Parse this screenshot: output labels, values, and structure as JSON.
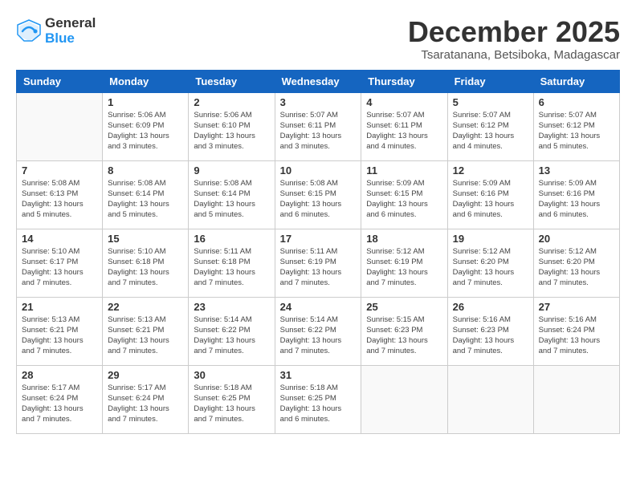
{
  "header": {
    "logo_general": "General",
    "logo_blue": "Blue",
    "month_title": "December 2025",
    "location": "Tsaratanana, Betsiboka, Madagascar"
  },
  "calendar": {
    "days_of_week": [
      "Sunday",
      "Monday",
      "Tuesday",
      "Wednesday",
      "Thursday",
      "Friday",
      "Saturday"
    ],
    "weeks": [
      [
        {
          "day": "",
          "info": ""
        },
        {
          "day": "1",
          "info": "Sunrise: 5:06 AM\nSunset: 6:09 PM\nDaylight: 13 hours\nand 3 minutes."
        },
        {
          "day": "2",
          "info": "Sunrise: 5:06 AM\nSunset: 6:10 PM\nDaylight: 13 hours\nand 3 minutes."
        },
        {
          "day": "3",
          "info": "Sunrise: 5:07 AM\nSunset: 6:11 PM\nDaylight: 13 hours\nand 3 minutes."
        },
        {
          "day": "4",
          "info": "Sunrise: 5:07 AM\nSunset: 6:11 PM\nDaylight: 13 hours\nand 4 minutes."
        },
        {
          "day": "5",
          "info": "Sunrise: 5:07 AM\nSunset: 6:12 PM\nDaylight: 13 hours\nand 4 minutes."
        },
        {
          "day": "6",
          "info": "Sunrise: 5:07 AM\nSunset: 6:12 PM\nDaylight: 13 hours\nand 5 minutes."
        }
      ],
      [
        {
          "day": "7",
          "info": "Sunrise: 5:08 AM\nSunset: 6:13 PM\nDaylight: 13 hours\nand 5 minutes."
        },
        {
          "day": "8",
          "info": "Sunrise: 5:08 AM\nSunset: 6:14 PM\nDaylight: 13 hours\nand 5 minutes."
        },
        {
          "day": "9",
          "info": "Sunrise: 5:08 AM\nSunset: 6:14 PM\nDaylight: 13 hours\nand 5 minutes."
        },
        {
          "day": "10",
          "info": "Sunrise: 5:08 AM\nSunset: 6:15 PM\nDaylight: 13 hours\nand 6 minutes."
        },
        {
          "day": "11",
          "info": "Sunrise: 5:09 AM\nSunset: 6:15 PM\nDaylight: 13 hours\nand 6 minutes."
        },
        {
          "day": "12",
          "info": "Sunrise: 5:09 AM\nSunset: 6:16 PM\nDaylight: 13 hours\nand 6 minutes."
        },
        {
          "day": "13",
          "info": "Sunrise: 5:09 AM\nSunset: 6:16 PM\nDaylight: 13 hours\nand 6 minutes."
        }
      ],
      [
        {
          "day": "14",
          "info": "Sunrise: 5:10 AM\nSunset: 6:17 PM\nDaylight: 13 hours\nand 7 minutes."
        },
        {
          "day": "15",
          "info": "Sunrise: 5:10 AM\nSunset: 6:18 PM\nDaylight: 13 hours\nand 7 minutes."
        },
        {
          "day": "16",
          "info": "Sunrise: 5:11 AM\nSunset: 6:18 PM\nDaylight: 13 hours\nand 7 minutes."
        },
        {
          "day": "17",
          "info": "Sunrise: 5:11 AM\nSunset: 6:19 PM\nDaylight: 13 hours\nand 7 minutes."
        },
        {
          "day": "18",
          "info": "Sunrise: 5:12 AM\nSunset: 6:19 PM\nDaylight: 13 hours\nand 7 minutes."
        },
        {
          "day": "19",
          "info": "Sunrise: 5:12 AM\nSunset: 6:20 PM\nDaylight: 13 hours\nand 7 minutes."
        },
        {
          "day": "20",
          "info": "Sunrise: 5:12 AM\nSunset: 6:20 PM\nDaylight: 13 hours\nand 7 minutes."
        }
      ],
      [
        {
          "day": "21",
          "info": "Sunrise: 5:13 AM\nSunset: 6:21 PM\nDaylight: 13 hours\nand 7 minutes."
        },
        {
          "day": "22",
          "info": "Sunrise: 5:13 AM\nSunset: 6:21 PM\nDaylight: 13 hours\nand 7 minutes."
        },
        {
          "day": "23",
          "info": "Sunrise: 5:14 AM\nSunset: 6:22 PM\nDaylight: 13 hours\nand 7 minutes."
        },
        {
          "day": "24",
          "info": "Sunrise: 5:14 AM\nSunset: 6:22 PM\nDaylight: 13 hours\nand 7 minutes."
        },
        {
          "day": "25",
          "info": "Sunrise: 5:15 AM\nSunset: 6:23 PM\nDaylight: 13 hours\nand 7 minutes."
        },
        {
          "day": "26",
          "info": "Sunrise: 5:16 AM\nSunset: 6:23 PM\nDaylight: 13 hours\nand 7 minutes."
        },
        {
          "day": "27",
          "info": "Sunrise: 5:16 AM\nSunset: 6:24 PM\nDaylight: 13 hours\nand 7 minutes."
        }
      ],
      [
        {
          "day": "28",
          "info": "Sunrise: 5:17 AM\nSunset: 6:24 PM\nDaylight: 13 hours\nand 7 minutes."
        },
        {
          "day": "29",
          "info": "Sunrise: 5:17 AM\nSunset: 6:24 PM\nDaylight: 13 hours\nand 7 minutes."
        },
        {
          "day": "30",
          "info": "Sunrise: 5:18 AM\nSunset: 6:25 PM\nDaylight: 13 hours\nand 7 minutes."
        },
        {
          "day": "31",
          "info": "Sunrise: 5:18 AM\nSunset: 6:25 PM\nDaylight: 13 hours\nand 6 minutes."
        },
        {
          "day": "",
          "info": ""
        },
        {
          "day": "",
          "info": ""
        },
        {
          "day": "",
          "info": ""
        }
      ]
    ]
  }
}
